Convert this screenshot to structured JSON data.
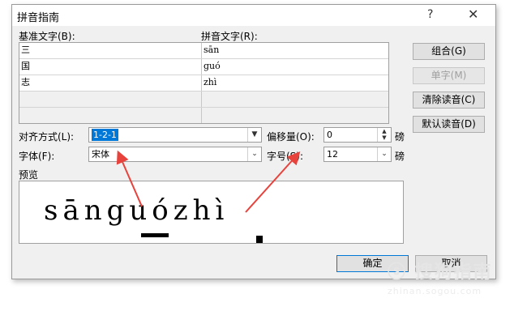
{
  "dialog": {
    "title": "拼音指南",
    "help": "?",
    "close": "✕"
  },
  "labels": {
    "base_text": "基准文字(B):",
    "pinyin_text": "拼音文字(R):"
  },
  "rows": [
    {
      "base": "三",
      "pinyin": "sān"
    },
    {
      "base": "国",
      "pinyin": "guó"
    },
    {
      "base": "志",
      "pinyin": "zhì"
    },
    {
      "base": "",
      "pinyin": ""
    },
    {
      "base": "",
      "pinyin": ""
    }
  ],
  "buttons": {
    "group": "组合(G)",
    "single": "单字(M)",
    "clear": "清除读音(C)",
    "default": "默认读音(D)",
    "ok": "确定",
    "cancel": "取消"
  },
  "settings": {
    "alignment_label": "对齐方式(L):",
    "alignment_value": "1-2-1",
    "offset_label": "偏移量(O):",
    "offset_value": "0",
    "offset_unit": "磅",
    "font_label": "字体(F):",
    "font_value": "宋体",
    "size_label": "字号(S):",
    "size_value": "12",
    "size_unit": "磅"
  },
  "preview": {
    "label": "预览",
    "ruby_text": "sānguózhì"
  },
  "watermark": {
    "line1": "ⓢ 搜狗指南",
    "line2": "zhinan.sogou.com"
  },
  "colors": {
    "annotation_arrow": "#e8423c",
    "accent": "#0078d7"
  }
}
